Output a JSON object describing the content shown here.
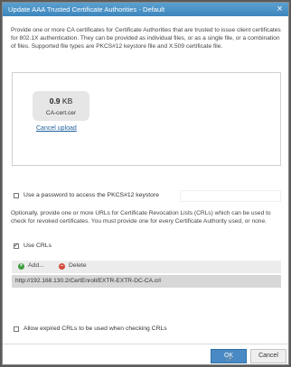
{
  "dialog": {
    "title": "Update AAA Trusted Certificate Authorities - Default",
    "intro": "Provide one or more CA certificates for Certificate Authorities that are trusted to issue client certificates for 802.1X authentication. They can be provided as individual files, or as a single file, or a combination of files. Supported file types are PKCS#12 keystore file and X.509 certificate file."
  },
  "upload": {
    "size_value": "0.9",
    "size_unit": "KB",
    "file_name": "CA-cert.cer",
    "cancel_label": "Cancel upload"
  },
  "password": {
    "checked": false,
    "label": "Use a password to access the PKCS#12 keystore"
  },
  "crl": {
    "note": "Optionally, provide one or more URLs for Certificate Revocation Lists (CRLs) which can be used to check for revoked certificates. You must provide one for every Certificate Authority used, or none.",
    "use_crls_checked": true,
    "use_crls_label": "Use CRLs",
    "add_label": "Add...",
    "delete_label": "Delete",
    "urls": [
      "http://192.168.130.2/CertEnroll/EXTR-EXTR-DC-CA.crl"
    ],
    "allow_expired_checked": false,
    "allow_expired_label": "Allow expired CRLs to be used when checking CRLs"
  },
  "footer": {
    "ok_label": "OK",
    "cancel_label": "Cancel"
  },
  "colors": {
    "titlebar": "#3d86bd",
    "ok_button": "#4a8ac4",
    "add_icon": "#3c9c3c",
    "delete_icon": "#d24b3b",
    "link": "#1f5f9e"
  }
}
